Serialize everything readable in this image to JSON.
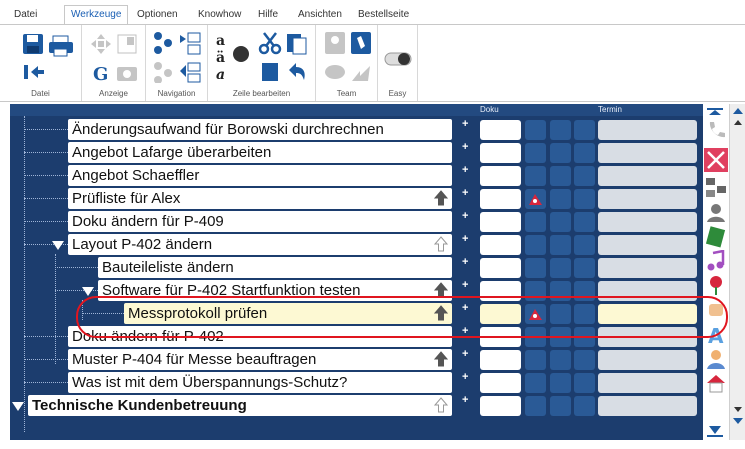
{
  "menu": {
    "tabs": [
      "Datei",
      "Werkzeuge",
      "Optionen",
      "Knowhow",
      "Hilfe",
      "Ansichten",
      "Bestellseite"
    ],
    "active_tab": "Werkzeuge"
  },
  "ribbon": {
    "groups": [
      "Datei",
      "Anzeige",
      "Navigation",
      "Zeile bearbeiten",
      "Team",
      "Easy"
    ]
  },
  "columns": {
    "doku": "Doku",
    "termin": "Termin"
  },
  "tree": {
    "rows": [
      {
        "label": "Änderungsaufwand für Borowski durchrechnen",
        "level": 1,
        "arrow": "none",
        "flag": false
      },
      {
        "label": "Angebot Lafarge überarbeiten",
        "level": 1,
        "arrow": "none",
        "flag": false
      },
      {
        "label": "Angebot Schaeffler",
        "level": 1,
        "arrow": "none",
        "flag": false
      },
      {
        "label": "Prüfliste für Alex",
        "level": 1,
        "arrow": "up-dark",
        "flag": true
      },
      {
        "label": "Doku ändern für P-409",
        "level": 1,
        "arrow": "none",
        "flag": false
      },
      {
        "label": "Layout P-402 ändern",
        "level": 1,
        "arrow": "up-light",
        "flag": false,
        "expanded": true
      },
      {
        "label": "Bauteileliste ändern",
        "level": 2,
        "arrow": "none",
        "flag": false
      },
      {
        "label": "Software für P-402 Startfunktion testen",
        "level": 2,
        "arrow": "up-dark",
        "flag": false,
        "expanded": true
      },
      {
        "label": "Messprotokoll prüfen",
        "level": 3,
        "arrow": "up-dark",
        "flag": true,
        "highlight": true
      },
      {
        "label": "Doku ändern für P-402",
        "level": 1,
        "arrow": "none",
        "flag": false
      },
      {
        "label": "Muster P-404 für Messe beauftragen",
        "level": 1,
        "arrow": "up-dark",
        "flag": false
      },
      {
        "label": "Was ist mit dem Überspannungs-Schutz?",
        "level": 1,
        "arrow": "none",
        "flag": false
      },
      {
        "label": "Technische Kundenbetreuung",
        "level": 0,
        "arrow": "up-light",
        "flag": false,
        "bold": true,
        "expanded": true
      }
    ]
  },
  "icons": {
    "side": [
      "phone-icon",
      "star-tool-icon",
      "network-icon",
      "people-icon",
      "book-icon",
      "music-note-icon",
      "rose-icon",
      "hand-icon",
      "letter-a-icon",
      "person-icon",
      "house-icon"
    ]
  },
  "colors": {
    "tree_bg": "#1c3d6e",
    "highlight": "#fdf9d3",
    "annotation": "#e0151f"
  }
}
